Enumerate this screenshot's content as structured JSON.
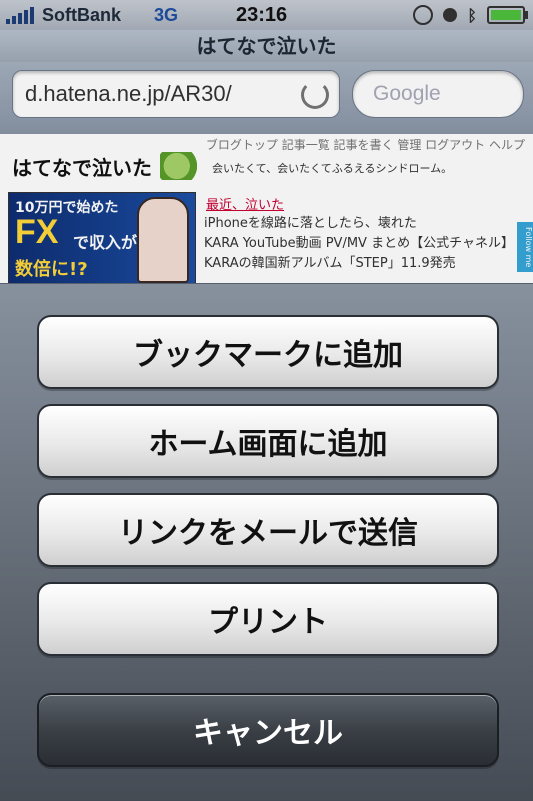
{
  "status": {
    "carrier": "SoftBank",
    "network": "3G",
    "time": "23:16"
  },
  "browser": {
    "title": "はてなで泣いた",
    "url": "d.hatena.ne.jp/AR30/",
    "search_placeholder": "Google"
  },
  "page": {
    "top_links": "ブログトップ 記事一覧 記事を書く 管理 ログアウト ヘルプ",
    "blog_title": "はてなで泣いた",
    "tagline": "会いたくて、会いたくてふるえるシンドローム。",
    "ad": {
      "line1": "10万円で始めた",
      "fx": "FX",
      "line2": "で収入が",
      "line3": "数倍に!?"
    },
    "recent_link": "最近、泣いた",
    "news": [
      "iPhoneを線路に落としたら、壊れた",
      "KARA YouTube動画 PV/MV まとめ【公式チャネル】",
      "KARAの韓国新アルバム「STEP」11.9発売"
    ],
    "follow_tab": "Follow me"
  },
  "action_sheet": {
    "buttons": [
      "ブックマークに追加",
      "ホーム画面に追加",
      "リンクをメールで送信",
      "プリント"
    ],
    "cancel": "キャンセル"
  }
}
